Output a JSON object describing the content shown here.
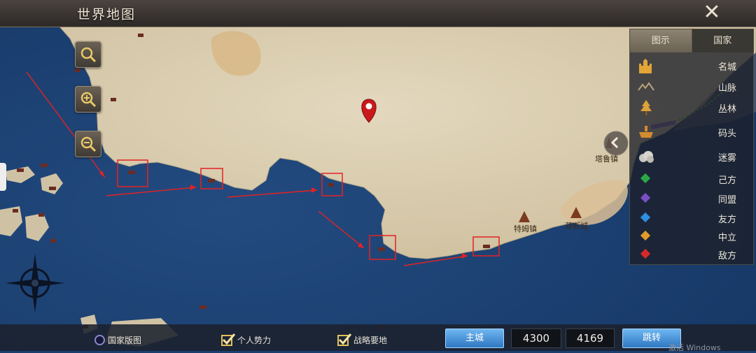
{
  "header": {
    "title": "世界地图",
    "close_icon": "close-icon"
  },
  "zoom_controls": {
    "icons": [
      "search-icon",
      "zoom-in-icon",
      "zoom-out-icon"
    ]
  },
  "legend": {
    "tabs": [
      "图示",
      "国家"
    ],
    "items": [
      {
        "label": "名城",
        "icon": "castle-icon"
      },
      {
        "label": "山脉",
        "icon": "mountain-icon"
      },
      {
        "label": "丛林",
        "icon": "tree-icon"
      },
      {
        "label": "码头",
        "icon": "ship-icon"
      },
      {
        "label": "迷雾",
        "icon": "fog-icon"
      },
      {
        "label": "己方",
        "color": "#2aa847"
      },
      {
        "label": "同盟",
        "color": "#7a4fc6"
      },
      {
        "label": "友方",
        "color": "#2f8fe0"
      },
      {
        "label": "中立",
        "color": "#e09b2a"
      },
      {
        "label": "敌方",
        "color": "#d62a2a"
      }
    ]
  },
  "towns": [
    "塔鲁镇",
    "特姆镇",
    "菲斯城"
  ],
  "bottom_bar": {
    "country_map": "国家版图",
    "personal_force": "个人势力",
    "strategic_place": "战略要地",
    "main_city_button": "主城",
    "coord_x": "4300",
    "coord_y": "4169",
    "jump_button": "跳转"
  },
  "watermark": "激活 Windows",
  "colors": {
    "ocean": "#1b3f6e",
    "land": "#ddd1b4",
    "annotation": "#e52222"
  }
}
